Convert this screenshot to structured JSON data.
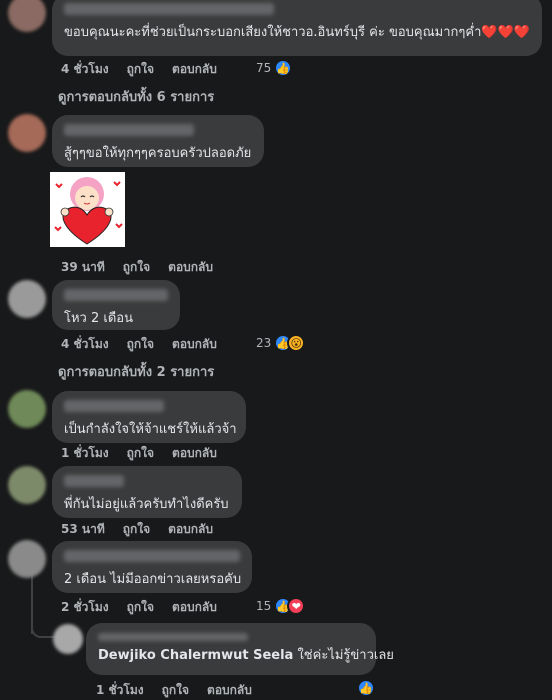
{
  "comments": [
    {
      "text": "ขอบคุณนะคะที่ช่วยเป็นกระบอกเสียงให้ชาวอ.อินทร์บุรี ค่ะ ขอบคุณมากๆค่ำ❤️❤️❤️",
      "time": "4 ชั่วโมง",
      "like": "ถูกใจ",
      "reply": "ตอบกลับ",
      "reaction_count": "75",
      "view_replies": "ดูการตอบกลับทั้ง 6 รายการ"
    },
    {
      "text": "สู้ๆๆขอให้ทุกๆๆครอบครัวปลอดภัย",
      "time": "39 นาที",
      "like": "ถูกใจ",
      "reply": "ตอบกลับ"
    },
    {
      "text": "โหว 2 เดือน",
      "time": "4 ชั่วโมง",
      "like": "ถูกใจ",
      "reply": "ตอบกลับ",
      "reaction_count": "23",
      "view_replies": "ดูการตอบกลับทั้ง 2 รายการ"
    },
    {
      "text": "เป็นกำลังใจให้จ้าแชร์ให้แล้วจ้า",
      "time": "1 ชั่วโมง",
      "like": "ถูกใจ",
      "reply": "ตอบกลับ"
    },
    {
      "text": "พี่กันไม่อยู่แล้วครับทำไงดีครับ",
      "time": "53 นาที",
      "like": "ถูกใจ",
      "reply": "ตอบกลับ"
    },
    {
      "text": "2 เดือน ไม่มีออกข่าวเลยหรอคับ",
      "time": "2 ชั่วโมง",
      "like": "ถูกใจ",
      "reply": "ตอบกลับ",
      "reaction_count": "15"
    }
  ],
  "reply": {
    "author": "Dewjiko Chalermwut Seela",
    "text": "ใช่ค่ะไม่รู้ข่าวเลย",
    "time": "1 ชั่วโมง",
    "like": "ถูกใจ",
    "reply": "ตอบกลับ"
  },
  "colors": {
    "background": "#18191a",
    "bubble": "#3a3b3c",
    "text": "#e4e6eb",
    "secondary": "#b0b3b8",
    "like_blue": "#2d88ff"
  }
}
